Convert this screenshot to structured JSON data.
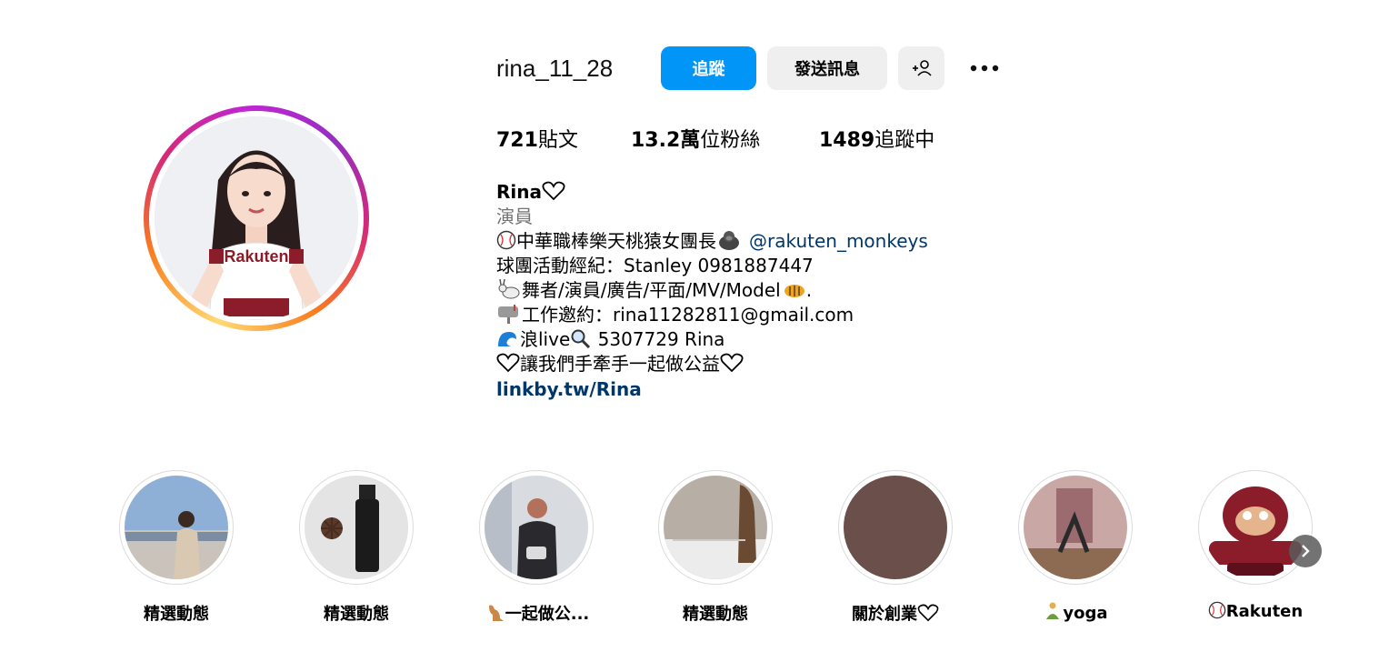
{
  "profile": {
    "username": "rina_11_28",
    "follow_label": "追蹤",
    "message_label": "發送訊息",
    "suggest_icon": "add-person-icon",
    "more_icon": "more-options-icon"
  },
  "stats": {
    "posts_count": "721",
    "posts_label": "貼文",
    "followers_count": "13.2萬",
    "followers_label": "位粉絲",
    "following_count": "1489",
    "following_label": "追蹤中"
  },
  "bio": {
    "name": "Rina",
    "category": "演員",
    "line1_text": "中華職棒樂天桃猿女團長",
    "line1_mention": "@rakuten_monkeys",
    "line2": "球團活動經紀：Stanley 0981887447",
    "line3": "舞者/演員/廣告/平面/MV/Model",
    "line3_end": ".",
    "line4": "工作邀約：rina11282811@gmail.com",
    "line5_a": "浪live",
    "line5_b": " 5307729 Rina",
    "line6": "讓我們手牽手一起做公益",
    "link": "linkby.tw/Rina"
  },
  "highlights": [
    {
      "label": "精選動態"
    },
    {
      "label": "精選動態"
    },
    {
      "label": "一起做公..."
    },
    {
      "label": "精選動態"
    },
    {
      "label": "關於創業"
    },
    {
      "label": "yoga"
    },
    {
      "label": "Rakuten"
    }
  ],
  "colors": {
    "primary_button": "#0095f6",
    "secondary_button": "#efefef",
    "link": "#00376b",
    "muted": "#737373"
  }
}
